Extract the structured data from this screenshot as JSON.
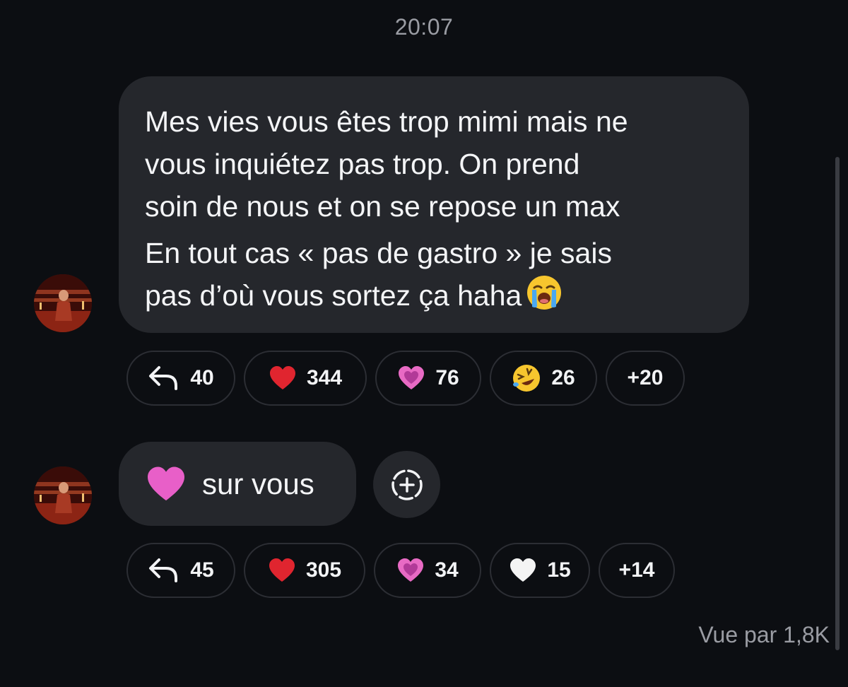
{
  "conversation": {
    "timestamp": "20:07",
    "seen_by": "Vue par 1,8K"
  },
  "messages": [
    {
      "lines": [
        "Mes vies vous êtes trop mimi mais ne",
        "vous inquiétez pas trop. On prend",
        "soin de nous et on se repose un max",
        "En tout cas « pas de gastro » je sais",
        "pas d’où vous sortez ça haha"
      ],
      "trailing_emoji": "loudly-crying-face-icon",
      "reactions": [
        {
          "icon": "reply-arrow-icon",
          "count": "40"
        },
        {
          "icon": "red-heart-icon",
          "count": "344"
        },
        {
          "icon": "sparkling-heart-icon",
          "count": "76"
        },
        {
          "icon": "rolling-laughing-face-icon",
          "count": "26"
        },
        {
          "icon": "",
          "count": "+20"
        }
      ]
    },
    {
      "emoji": "pink-heart-icon",
      "text": "sur vous",
      "reactions": [
        {
          "icon": "reply-arrow-icon",
          "count": "45"
        },
        {
          "icon": "red-heart-icon",
          "count": "305"
        },
        {
          "icon": "sparkling-heart-icon",
          "count": "34"
        },
        {
          "icon": "white-heart-icon",
          "count": "15"
        },
        {
          "icon": "",
          "count": "+14"
        }
      ]
    }
  ],
  "colors": {
    "background": "#0c0e12",
    "bubble": "#25272c",
    "pill_border": "#2c2e34",
    "muted_text": "#9a9ca3",
    "red_heart": "#e0252f",
    "pink_heart": "#e85fc8"
  }
}
